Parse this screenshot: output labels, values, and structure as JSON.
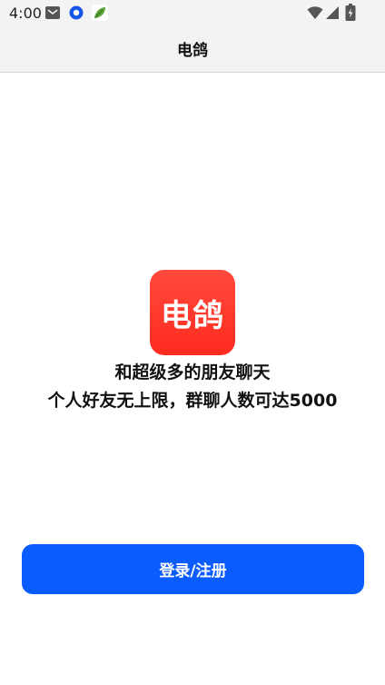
{
  "status_bar": {
    "time": "4:00",
    "icons": [
      "mail-icon",
      "blue-circle-app-icon",
      "leaf-app-icon",
      "wifi-icon",
      "signal-icon",
      "battery-icon"
    ]
  },
  "app_bar": {
    "title": "电鸽"
  },
  "logo": {
    "text": "电鸽",
    "color": "#ff3326"
  },
  "tagline": {
    "line1": "和超级多的朋友聊天",
    "line2": "个人好友无上限，群聊人数可达5000"
  },
  "actions": {
    "login_label": "登录/注册",
    "accent": "#0a5cff"
  }
}
